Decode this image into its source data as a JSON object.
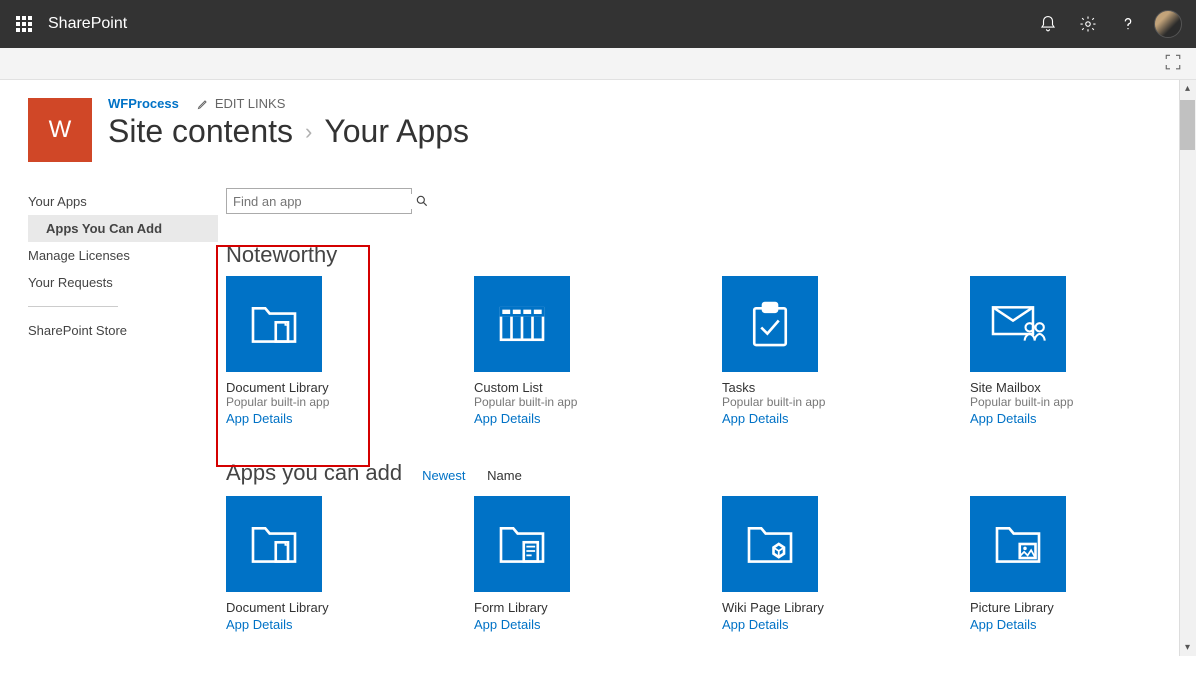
{
  "suite": {
    "brand": "SharePoint"
  },
  "ribbon": {},
  "site": {
    "logo_letter": "W",
    "name": "WFProcess",
    "edit_links_label": "EDIT LINKS",
    "title_part1": "Site contents",
    "title_part2": "Your Apps"
  },
  "leftnav": {
    "your_apps": "Your Apps",
    "apps_you_can_add": "Apps You Can Add",
    "manage_licenses": "Manage Licenses",
    "your_requests": "Your Requests",
    "sharepoint_store": "SharePoint Store"
  },
  "search": {
    "placeholder": "Find an app"
  },
  "noteworthy": {
    "heading": "Noteworthy",
    "apps": [
      {
        "title": "Document Library",
        "sub": "Popular built-in app",
        "details": "App Details"
      },
      {
        "title": "Custom List",
        "sub": "Popular built-in app",
        "details": "App Details"
      },
      {
        "title": "Tasks",
        "sub": "Popular built-in app",
        "details": "App Details"
      },
      {
        "title": "Site Mailbox",
        "sub": "Popular built-in app",
        "details": "App Details"
      }
    ]
  },
  "addable": {
    "heading": "Apps you can add",
    "sort_newest": "Newest",
    "sort_name": "Name",
    "apps": [
      {
        "title": "Document Library",
        "details": "App Details"
      },
      {
        "title": "Form Library",
        "details": "App Details"
      },
      {
        "title": "Wiki Page Library",
        "details": "App Details"
      },
      {
        "title": "Picture Library",
        "details": "App Details"
      }
    ]
  }
}
